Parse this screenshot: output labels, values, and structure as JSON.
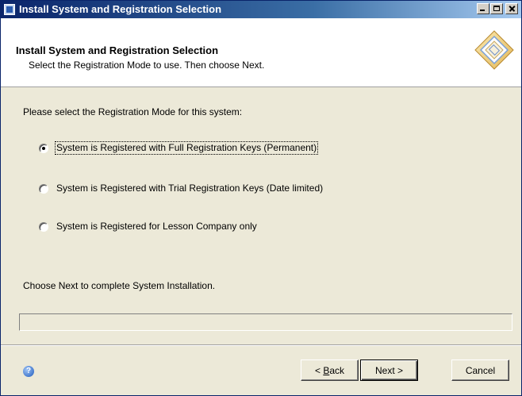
{
  "window": {
    "title": "Install System and Registration Selection"
  },
  "header": {
    "title": "Install System and Registration Selection",
    "subtitle": "Select the Registration Mode to use. Then choose Next."
  },
  "body": {
    "prompt": "Please select the Registration Mode for this system:",
    "options": [
      {
        "label": "System is Registered with Full Registration Keys (Permanent)",
        "selected": true
      },
      {
        "label": "System is Registered with Trial Registration Keys (Date limited)",
        "selected": false
      },
      {
        "label": "System is Registered for Lesson Company only",
        "selected": false
      }
    ],
    "next_hint": "Choose Next to complete System Installation."
  },
  "footer": {
    "back_prefix": "< ",
    "back_accel": "B",
    "back_rest": "ack",
    "next_label": "Next >",
    "cancel_label": "Cancel"
  },
  "icons": {
    "app": "window-app-icon",
    "logo": "diamond-logo-icon",
    "help": "help-icon"
  },
  "colors": {
    "titlebar_start": "#0a246a",
    "titlebar_end": "#a6caf0",
    "dialog_bg": "#ece9d8"
  }
}
